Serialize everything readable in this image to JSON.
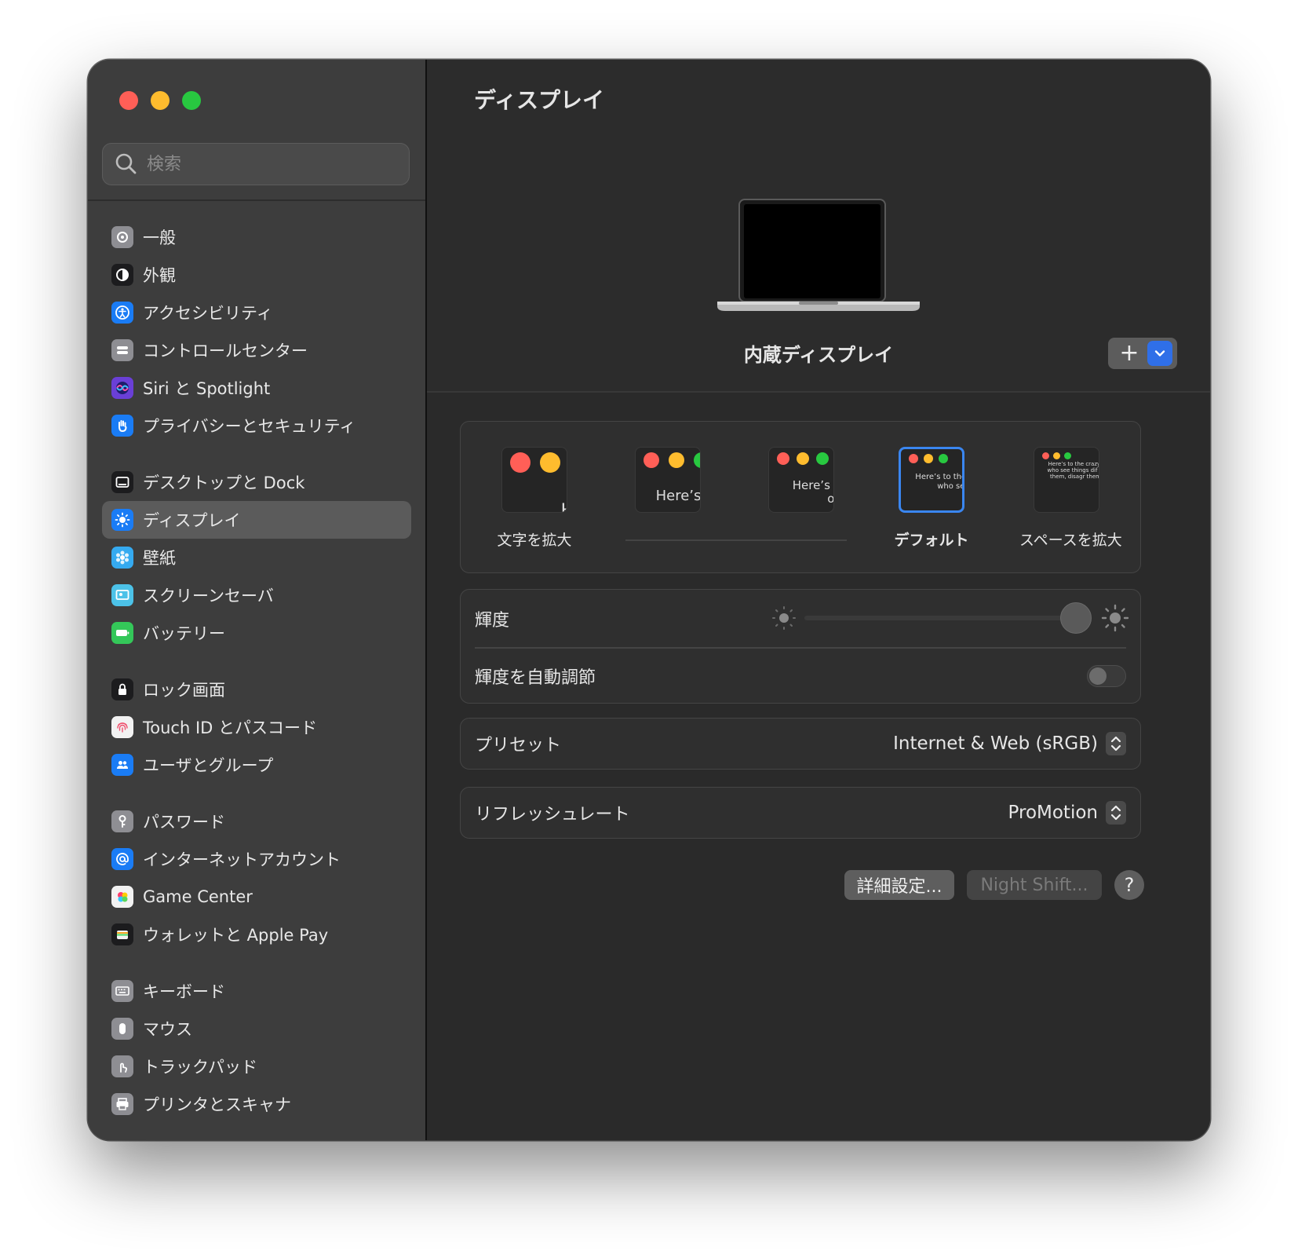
{
  "window": {
    "traffic_lights": [
      "#ff5f57",
      "#febc2e",
      "#28c840"
    ]
  },
  "sidebar": {
    "search_placeholder": "検索",
    "groups": [
      [
        {
          "label": "一般",
          "icon": "gear-icon",
          "color": "#8e8e93"
        },
        {
          "label": "外観",
          "icon": "appearance-icon",
          "color": "#1c1c1e"
        },
        {
          "label": "アクセシビリティ",
          "icon": "accessibility-icon",
          "color": "#1a7cf5"
        },
        {
          "label": "コントロールセンター",
          "icon": "control-center-icon",
          "color": "#8e8e93"
        },
        {
          "label": "Siri と Spotlight",
          "icon": "siri-icon",
          "color": "#6a3fd6"
        },
        {
          "label": "プライバシーとセキュリティ",
          "icon": "hand-icon",
          "color": "#1a7cf5"
        }
      ],
      [
        {
          "label": "デスクトップと Dock",
          "icon": "dock-icon",
          "color": "#1c1c1e"
        },
        {
          "label": "ディスプレイ",
          "icon": "brightness-icon",
          "color": "#1a7cf5",
          "active": true
        },
        {
          "label": "壁紙",
          "icon": "wallpaper-icon",
          "color": "#35aaf0"
        },
        {
          "label": "スクリーンセーバ",
          "icon": "screensaver-icon",
          "color": "#4cc2e8"
        },
        {
          "label": "バッテリー",
          "icon": "battery-icon",
          "color": "#34c759"
        }
      ],
      [
        {
          "label": "ロック画面",
          "icon": "lock-icon",
          "color": "#1c1c1e"
        },
        {
          "label": "Touch ID とパスコード",
          "icon": "fingerprint-icon",
          "color": "#f2f2f2"
        },
        {
          "label": "ユーザとグループ",
          "icon": "users-icon",
          "color": "#1a7cf5"
        }
      ],
      [
        {
          "label": "パスワード",
          "icon": "key-icon",
          "color": "#8e8e93"
        },
        {
          "label": "インターネットアカウント",
          "icon": "at-icon",
          "color": "#1a7cf5"
        },
        {
          "label": "Game Center",
          "icon": "game-center-icon",
          "color": "#f2f2f2"
        },
        {
          "label": "ウォレットと Apple Pay",
          "icon": "wallet-icon",
          "color": "#1c1c1e"
        }
      ],
      [
        {
          "label": "キーボード",
          "icon": "keyboard-icon",
          "color": "#8e8e93"
        },
        {
          "label": "マウス",
          "icon": "mouse-icon",
          "color": "#8e8e93"
        },
        {
          "label": "トラックパッド",
          "icon": "trackpad-icon",
          "color": "#8e8e93"
        },
        {
          "label": "プリンタとスキャナ",
          "icon": "printer-icon",
          "color": "#8e8e93"
        }
      ]
    ]
  },
  "main": {
    "title": "ディスプレイ",
    "display_name": "内蔵ディスプレイ",
    "add_button": "+",
    "resolution": {
      "options": [
        {
          "label": "文字を拡大",
          "preview": "Here’s",
          "selected": false,
          "show_label": true
        },
        {
          "label": "",
          "preview": "Here’s to troublem",
          "selected": false,
          "show_label": false
        },
        {
          "label": "",
          "preview": "Here’s to t troublema ones who",
          "selected": false,
          "show_label": false
        },
        {
          "label": "デフォルト",
          "preview": "Here’s to the cr troublemakers. ones who see t rules. And they",
          "selected": true,
          "show_label": true
        },
        {
          "label": "スペースを拡大",
          "preview": "Here’s to the crazy one troublemakers. The rou ones who see things dif rules. And they have no can quote them, disagr them. About the only th Because they change tl",
          "selected": false,
          "show_label": true
        }
      ]
    },
    "brightness": {
      "label": "輝度",
      "value": 1.0,
      "auto_label": "輝度を自動調節",
      "auto_enabled": false
    },
    "preset": {
      "label": "プリセット",
      "value": "Internet & Web (sRGB)"
    },
    "refresh_rate": {
      "label": "リフレッシュレート",
      "value": "ProMotion"
    },
    "buttons": {
      "advanced": "詳細設定...",
      "night_shift": "Night Shift...",
      "help": "?"
    }
  }
}
